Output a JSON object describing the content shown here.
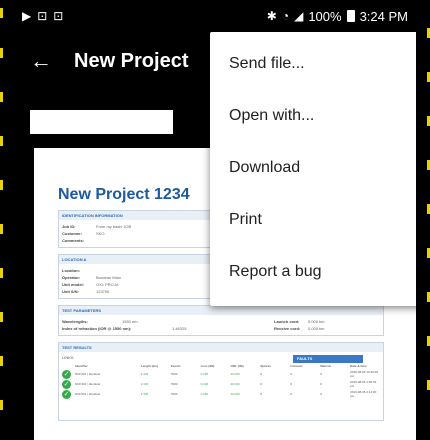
{
  "status_bar": {
    "left_icons": [
      "play-icon",
      "notification-icon",
      "notification-icon"
    ],
    "right_icons": [
      "bluetooth-icon",
      "wifi-icon",
      "signal-icon"
    ],
    "battery": "100%",
    "time": "3:24 PM"
  },
  "app_bar": {
    "back_icon": "arrow-left-icon",
    "title": "New Project"
  },
  "document": {
    "title": "New Project 1234",
    "identification": {
      "heading": "IDENTIFICATION INFORMATION",
      "fields": [
        {
          "label": "Job ID:",
          "value": "From my basic JOB"
        },
        {
          "label": "Customer:",
          "value": "SKO"
        },
        {
          "label": "Comments:",
          "value": ""
        }
      ]
    },
    "location": {
      "heading": "LOCATION A",
      "fields": [
        {
          "label": "Location:",
          "value": ""
        },
        {
          "label": "Operator:",
          "value": "Bordeau Marc"
        },
        {
          "label": "Unit model:",
          "value": "OX1 PRO-M"
        },
        {
          "label": "Unit S/N:",
          "value": "123706"
        }
      ]
    },
    "test_parameters": {
      "heading": "TEST PARAMETERS",
      "fields": [
        {
          "label": "Wavelengths:",
          "value": "1550 nm"
        },
        {
          "label": "Index of refraction (IOR @ 1550 nm):",
          "value": "1.46325"
        }
      ],
      "right_fields": [
        {
          "label": "Launch cord:",
          "value": "0.000 km"
        },
        {
          "label": "Receive cord:",
          "value": "0.000 km"
        }
      ]
    },
    "test_results": {
      "heading": "TEST RESULTS",
      "subheading": "LINKS",
      "tag": "FAULTS",
      "columns": [
        "Identifier",
        "Length (km)",
        "Events",
        "Loss (dB)",
        "ORL (dB)",
        "Splices",
        "Connect.",
        "Macrob.",
        "Date & time"
      ],
      "rows": [
        {
          "id": "N00 001 | Identical",
          "length": "2.303",
          "events": "7000",
          "loss": "0.135",
          "orl": "40.025",
          "splices": "0",
          "connect": "0",
          "macrob": "0",
          "date": "2019-08-06 12:30:00 pm"
        },
        {
          "id": "N00 001 | Identical",
          "length": "2.303",
          "events": "7000",
          "loss": "0.130",
          "orl": "40.040",
          "splices": "0",
          "connect": "0",
          "macrob": "0",
          "date": "2019-08-06 1:00:03 pm"
        },
        {
          "id": "N00 001 | Identical",
          "length": "2.303",
          "events": "7000",
          "loss": "0.135",
          "orl": "40.025",
          "splices": "0",
          "connect": "0",
          "macrob": "0",
          "date": "2019-08-06 2:14:00 pm"
        }
      ]
    }
  },
  "menu": {
    "items": [
      {
        "label": "Send file..."
      },
      {
        "label": "Open with..."
      },
      {
        "label": "Download"
      },
      {
        "label": "Print"
      },
      {
        "label": "Report a bug"
      }
    ]
  },
  "colors": {
    "accent": "#1c5a9e",
    "edge_dash": "#e8d200",
    "pass": "#36a84a"
  }
}
